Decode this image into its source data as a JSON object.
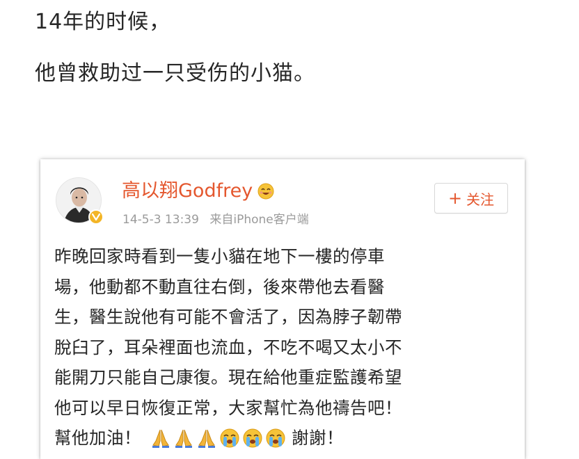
{
  "article": {
    "line1": "14年的时候，",
    "line2": "他曾救助过一只受伤的小猫。"
  },
  "weibo": {
    "user_name": "高以翔Godfrey",
    "name_emoji": "smiling-face-emoji-icon",
    "timestamp": "14-5-3 13:39",
    "source": "来自iPhone客户端",
    "follow_label": "关注",
    "follow_plus": "+",
    "body_lines": [
      "昨晚回家時看到一隻小貓在地下一樓的停車",
      "場，他動都不動直往右倒，後來帶他去看醫",
      "生，醫生說他有可能不會活了，因為脖子韌帶",
      "脫臼了，耳朵裡面也流血，不吃不喝又太小不",
      "能開刀只能自己康復。現在給他重症監護希望",
      "他可以早日恢復正常，大家幫忙為他禱告吧！"
    ],
    "last_line_start": "幫他加油！",
    "last_line_end": "謝謝！",
    "emojis": [
      "praying-hands-icon",
      "praying-hands-icon",
      "praying-hands-icon",
      "crying-face-icon",
      "crying-face-icon",
      "crying-face-icon"
    ],
    "colors": {
      "accent": "#e4572e",
      "meta": "#9a9a9a",
      "badge": "#f3b526"
    }
  }
}
